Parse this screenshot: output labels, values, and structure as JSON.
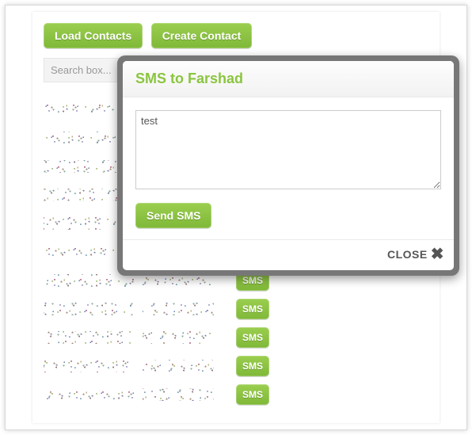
{
  "toolbar": {
    "load_contacts": "Load Contacts",
    "create_contact": "Create Contact"
  },
  "search": {
    "placeholder": "Search box..."
  },
  "contacts": {
    "sms_label": "SMS",
    "rows": 11
  },
  "modal": {
    "title": "SMS to Farshad",
    "message_value": "test",
    "send_label": "Send SMS",
    "close_label": "CLOSE"
  }
}
